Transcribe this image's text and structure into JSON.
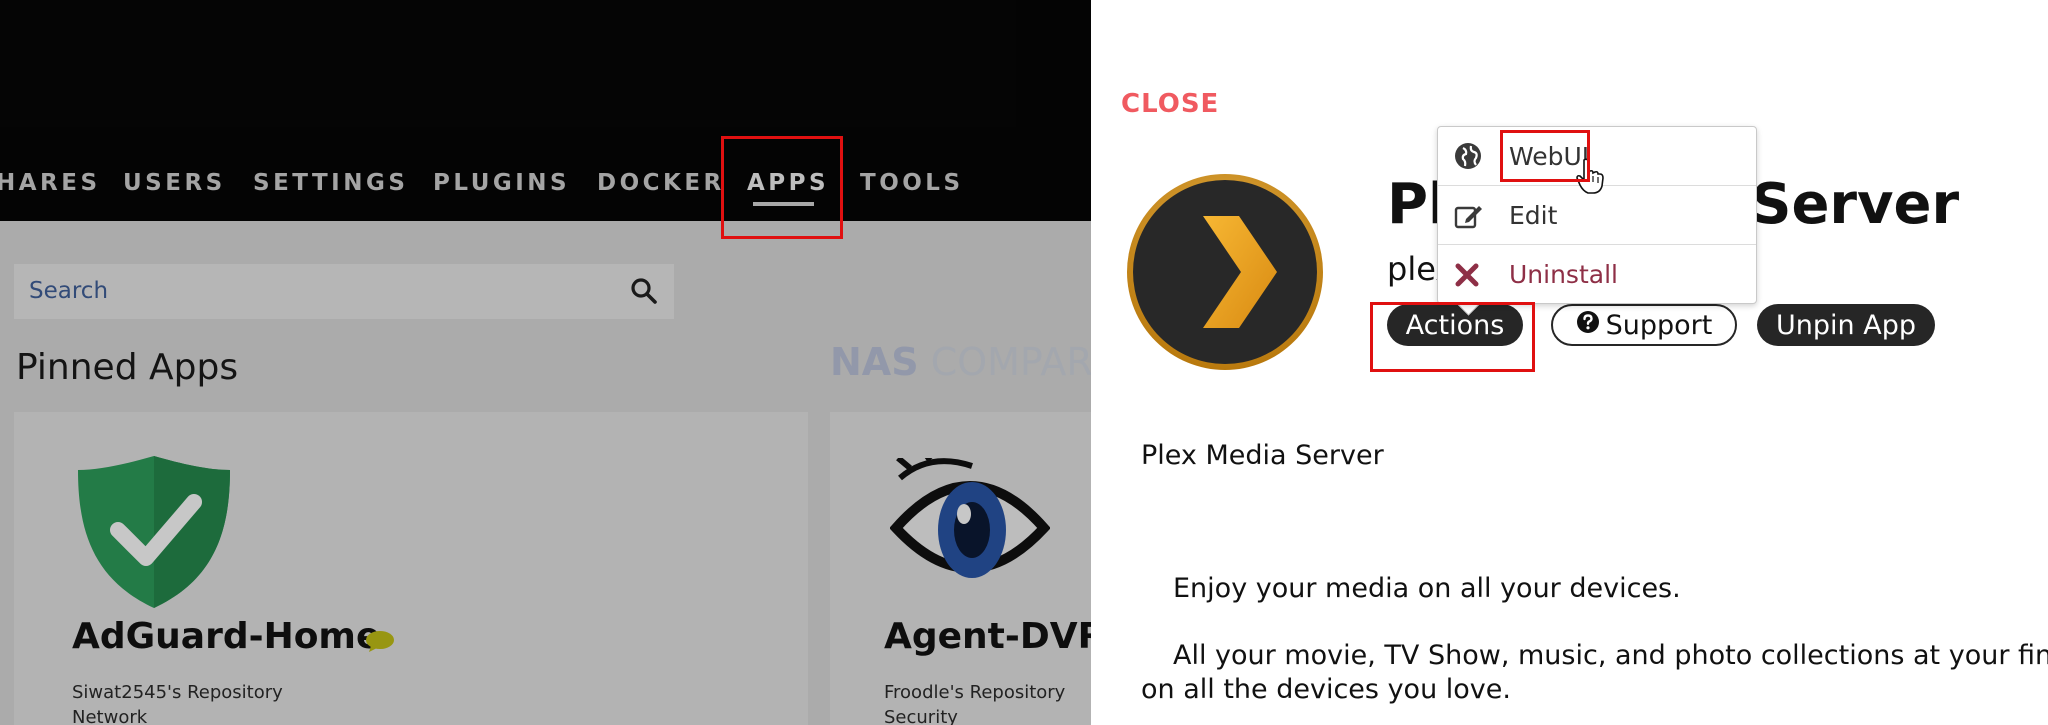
{
  "nav": {
    "items": [
      {
        "label": "HARES"
      },
      {
        "label": "USERS"
      },
      {
        "label": "SETTINGS"
      },
      {
        "label": "PLUGINS"
      },
      {
        "label": "DOCKER"
      },
      {
        "label": "APPS"
      },
      {
        "label": "TOOLS"
      }
    ],
    "active": "APPS"
  },
  "search": {
    "placeholder": "Search"
  },
  "pinned": {
    "title": "Pinned Apps",
    "apps": [
      {
        "name": "AdGuard-Home",
        "repo": "Siwat2545's Repository",
        "category": "Network"
      },
      {
        "name": "Agent-DVR",
        "repo": "Froodle's Repository",
        "category": "Security"
      }
    ]
  },
  "panel": {
    "close_label": "CLOSE",
    "app_title": "Plex Media Server",
    "app_subtitle": "plex",
    "buttons": {
      "actions": "Actions",
      "support": "Support",
      "unpin": "Unpin App"
    },
    "menu": {
      "items": [
        {
          "label": "WebUI",
          "icon": "globe-icon"
        },
        {
          "label": "Edit",
          "icon": "edit-icon"
        },
        {
          "label": "Uninstall",
          "icon": "x-icon"
        }
      ]
    },
    "description": {
      "name": "Plex Media Server",
      "line1": "Enjoy your media on all your devices.",
      "line2": "All your movie, TV Show, music, and photo collections at your fing",
      "line3": "on all the devices you love."
    }
  },
  "watermark": {
    "part1": "NAS",
    "part2": "COMPARES"
  },
  "colors": {
    "close": "#f05a60",
    "highlight_box": "#e01010",
    "plex_orange": "#e5a00d",
    "adguard_green": "#2e9e5b"
  }
}
